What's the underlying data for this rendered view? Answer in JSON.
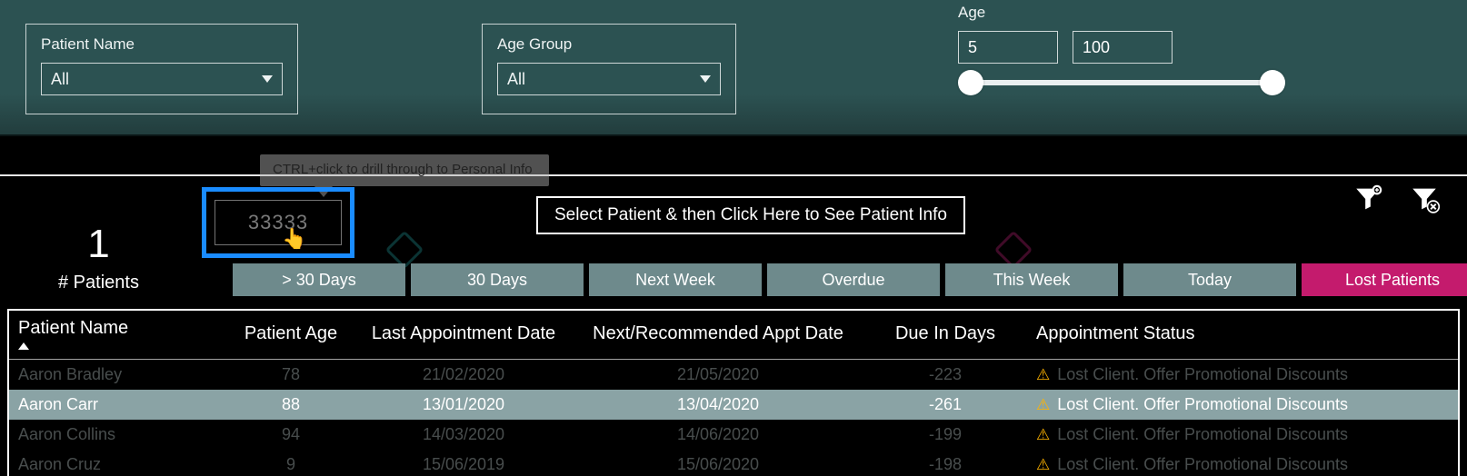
{
  "filters": {
    "patient_name": {
      "label": "Patient Name",
      "value": "All"
    },
    "age_group": {
      "label": "Age Group",
      "value": "All"
    },
    "age_slider": {
      "label": "Age",
      "min": "5",
      "max": "100"
    }
  },
  "tooltip": "CTRL+click to drill through to Personal Info",
  "drill_box_value": "33333",
  "info_banner": "Select Patient & then Click Here to See Patient Info",
  "count_card": {
    "value": "1",
    "label": "# Patients"
  },
  "tabs": [
    {
      "label": "> 30 Days"
    },
    {
      "label": "30 Days"
    },
    {
      "label": "Next Week"
    },
    {
      "label": "Overdue"
    },
    {
      "label": "This Week"
    },
    {
      "label": "Today"
    },
    {
      "label": "Lost Patients",
      "variant": "lost"
    }
  ],
  "table": {
    "headers": {
      "name": "Patient Name",
      "age": "Patient Age",
      "last": "Last Appointment Date",
      "next": "Next/Recommended Appt Date",
      "due": "Due In Days",
      "status": "Appointment Status"
    },
    "rows": [
      {
        "name": "Aaron Bradley",
        "age": "78",
        "last": "21/02/2020",
        "next": "21/05/2020",
        "due": "-223",
        "status": "Lost Client. Offer Promotional Discounts",
        "sel": false
      },
      {
        "name": "Aaron Carr",
        "age": "88",
        "last": "13/01/2020",
        "next": "13/04/2020",
        "due": "-261",
        "status": "Lost Client. Offer Promotional Discounts",
        "sel": true
      },
      {
        "name": "Aaron Collins",
        "age": "94",
        "last": "14/03/2020",
        "next": "14/06/2020",
        "due": "-199",
        "status": "Lost Client. Offer Promotional Discounts",
        "sel": false
      },
      {
        "name": "Aaron Cruz",
        "age": "9",
        "last": "15/06/2019",
        "next": "15/06/2020",
        "due": "-198",
        "status": "Lost Client. Offer Promotional Discounts",
        "sel": false
      }
    ]
  }
}
